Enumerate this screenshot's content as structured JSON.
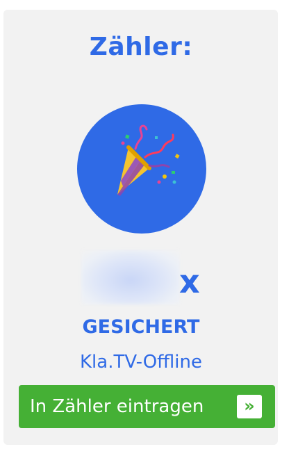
{
  "widget": {
    "title": "Zähler:",
    "icon": "party-popper-icon",
    "count_suffix": "x",
    "status": "GESICHERT",
    "subtitle": "Kla.TV-Offline",
    "button": {
      "label": "In Zähler eintragen",
      "arrow": "»"
    }
  },
  "colors": {
    "accent": "#2f6ae6",
    "panel": "#f2f2f2",
    "button": "#45b035"
  }
}
